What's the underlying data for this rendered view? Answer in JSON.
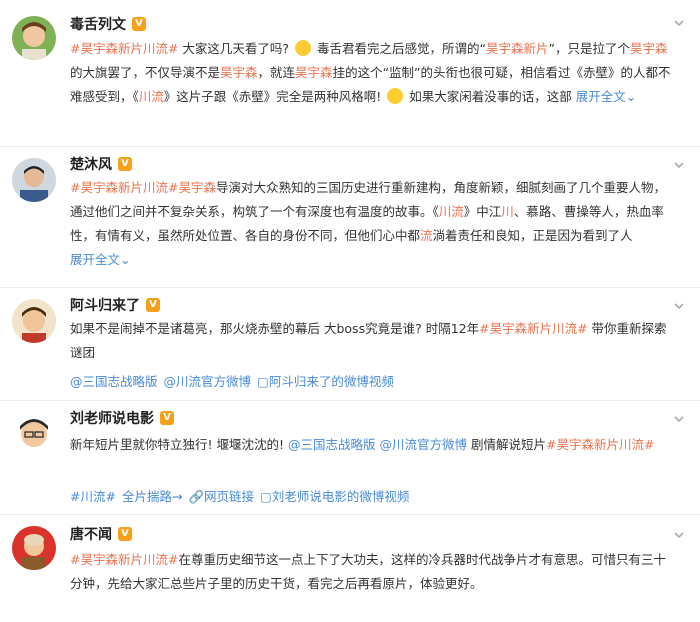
{
  "posts": [
    {
      "name": "毒舌列文",
      "badge": "V",
      "segments": [
        [
          "#昊宇森新片川流#",
          "tag"
        ],
        [
          " 大家这几天看了吗? ",
          "text"
        ],
        [
          "",
          "emoji"
        ],
        [
          " 毒舌君看完之后感觉，所谓的“",
          "text"
        ],
        [
          "昊宇森新片",
          "kw"
        ],
        [
          "”，只是拉了个",
          "text"
        ],
        [
          "昊宇森",
          "kw"
        ],
        [
          "的大旗罢了，不仅导演不是",
          "text"
        ],
        [
          "昊宇森",
          "kw"
        ],
        [
          "，就连",
          "text"
        ],
        [
          "昊宇森",
          "kw"
        ],
        [
          "挂的这个“监制”的头衔也很可疑，相信看过《赤壁》的人都不难感受到，《",
          "text"
        ],
        [
          "川流",
          "kw"
        ],
        [
          "》这片子跟《赤壁》完全是两种风格啊! ",
          "text"
        ],
        [
          "",
          "emoji"
        ],
        [
          " 如果大家闲着没事的话，这部 ",
          "text"
        ],
        [
          "展开全文⌄",
          "more"
        ]
      ]
    },
    {
      "name": "楚沐风",
      "badge": "V",
      "segments": [
        [
          "#昊宇森新片川流#",
          "tag"
        ],
        [
          "昊宇森",
          "kw"
        ],
        [
          "导演对大众熟知的三国历史进行重新建构，角度新颖，细腻刻画了几个重要人物，通过他们之间并不复杂关系，构筑了一个有深度也有温度的故事。《",
          "text"
        ],
        [
          "川流",
          "kw"
        ],
        [
          "》中江",
          "text"
        ],
        [
          "川",
          "kw"
        ],
        [
          "、慕路、曹操等人，热血率性，有情有义，虽然所处位置、各自的身份不同，但他们心中都",
          "text"
        ],
        [
          "流",
          "kw"
        ],
        [
          "淌着责任和良知，正是因为看到了人 ",
          "text"
        ],
        [
          "展开全文⌄",
          "more"
        ]
      ]
    },
    {
      "name": "阿斗归来了",
      "badge": "V",
      "segments": [
        [
          "如果不是闹掉不是诸葛亮，那火烧赤壁的幕后 大boss究竟是谁? 时隔12年",
          "text"
        ],
        [
          "#昊宇森新片川流#",
          "tag"
        ],
        [
          " 带你重新探索谜团",
          "text"
        ]
      ],
      "meta": [
        "@三国志战略版",
        "@川流官方微博",
        "▢阿斗归来了的微博视频"
      ]
    },
    {
      "name": "刘老师说电影",
      "badge": "V",
      "segments": [
        [
          "新年短片里就你特立独行! 堰堰沈沈的! ",
          "text"
        ],
        [
          "@三国志战略版",
          "blue"
        ],
        [
          " ",
          "text"
        ],
        [
          "@川流官方微博",
          "blue"
        ],
        [
          " 剧情解说短片",
          "text"
        ],
        [
          "#昊宇森新片川流#",
          "tag"
        ]
      ],
      "meta": [
        "#川流#",
        "全片揣路→",
        "🔗网页链接",
        "▢刘老师说电影的微博视频"
      ]
    },
    {
      "name": "唐不闻",
      "badge": "V",
      "segments": [
        [
          "#昊宇森新片川流#",
          "tag"
        ],
        [
          "在尊重历史细节这一点上下了大功夫，这样的冷兵器时代战争片才有意思。可惜只有三十分钟，先给大家汇总些片子里的历史干货，看完之后再看原片，体验更好。",
          "text"
        ]
      ]
    }
  ],
  "colors": {
    "accent": "#eb7350",
    "link": "#4a8bd6",
    "badge": "#f7a11a"
  }
}
